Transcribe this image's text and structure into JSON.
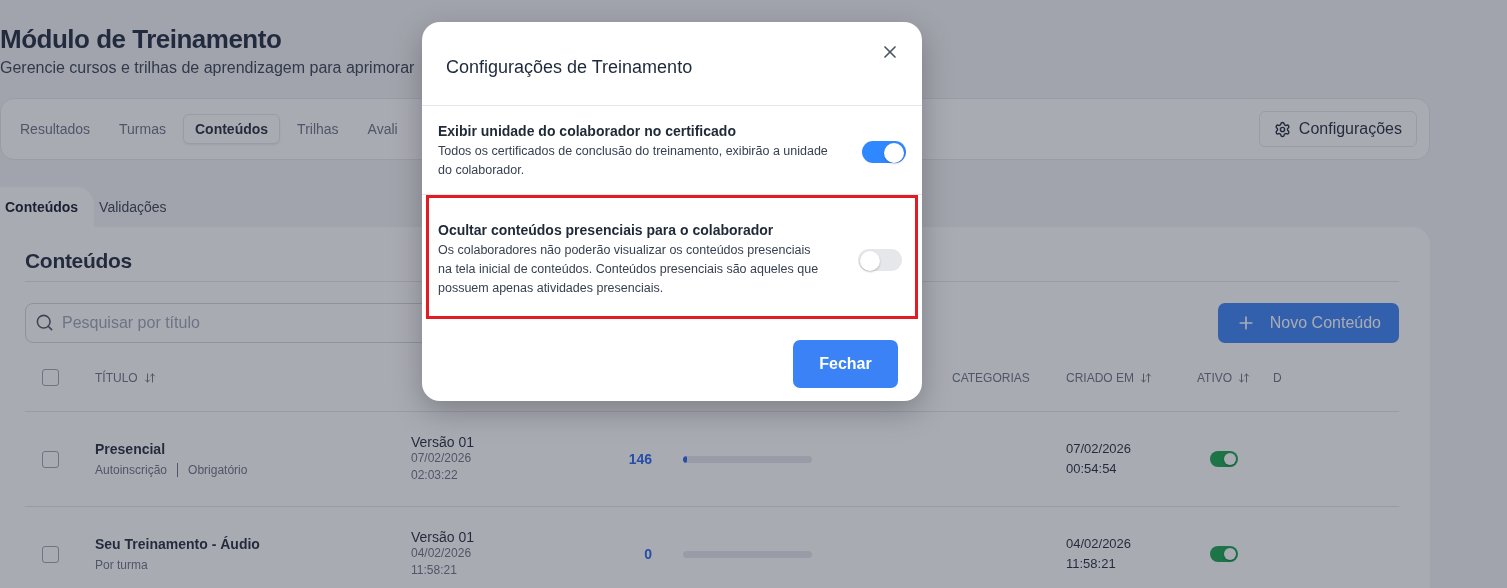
{
  "page": {
    "title": "Módulo de Treinamento",
    "subtitle": "Gerencie cursos e trilhas de aprendizagem para aprimorar"
  },
  "nav_tabs": [
    {
      "label": "Resultados",
      "selected": false
    },
    {
      "label": "Turmas",
      "selected": false
    },
    {
      "label": "Conteúdos",
      "selected": true
    },
    {
      "label": "Trilhas",
      "selected": false
    },
    {
      "label": "Avali",
      "selected": false
    }
  ],
  "settings_button": "Configurações",
  "sub_tabs": [
    {
      "label": "Conteúdos",
      "selected": true
    },
    {
      "label": "Validações",
      "selected": false
    }
  ],
  "section": {
    "heading": "Conteúdos",
    "search": {
      "placeholder": "Pesquisar por título"
    },
    "new_button": "Novo Conteúdo"
  },
  "table": {
    "select_all": {
      "checked": false
    },
    "columns": [
      {
        "label": "TÍTULO",
        "sortable": true
      },
      {
        "label": "CATEGORIAS",
        "sortable": false
      },
      {
        "label": "CRIADO EM",
        "sortable": true
      },
      {
        "label": "ATIVO",
        "sortable": true
      },
      {
        "label": "D",
        "sortable": false
      }
    ],
    "rows": [
      {
        "checked": false,
        "title": "Presencial",
        "tags": [
          "Autoinscrição",
          "Obrigatório"
        ],
        "version": "Versão 01",
        "version_date": "07/02/2026",
        "version_time": "02:03:22",
        "count": "146",
        "level": 0.03,
        "created_date": "07/02/2026",
        "created_time": "00:54:54",
        "active": true
      },
      {
        "checked": false,
        "title": "Seu Treinamento - Áudio",
        "tags": [
          "Por turma"
        ],
        "version": "Versão 01",
        "version_date": "04/02/2026",
        "version_time": "11:58:21",
        "count": "0",
        "created_date": "04/02/2026",
        "created_time": "11:58:21",
        "active": true
      }
    ]
  },
  "dialog": {
    "title": "Configurações de Treinamento",
    "settings": [
      {
        "label": "Exibir unidade do colaborador no certificado",
        "description": "Todos os certificados de conclusão do treinamento, exibirão a unidade do colaborador.",
        "on": true,
        "highlighted": false
      },
      {
        "label": "Ocultar conteúdos presenciais para o colaborador",
        "description": "Os colaboradores não poderão visualizar os conteúdos presenciais na tela inicial de conteúdos. Conteúdos presenciais são aqueles que possuem apenas atividades presenciais.",
        "on": false,
        "highlighted": true
      }
    ],
    "close_button": "Fechar"
  }
}
